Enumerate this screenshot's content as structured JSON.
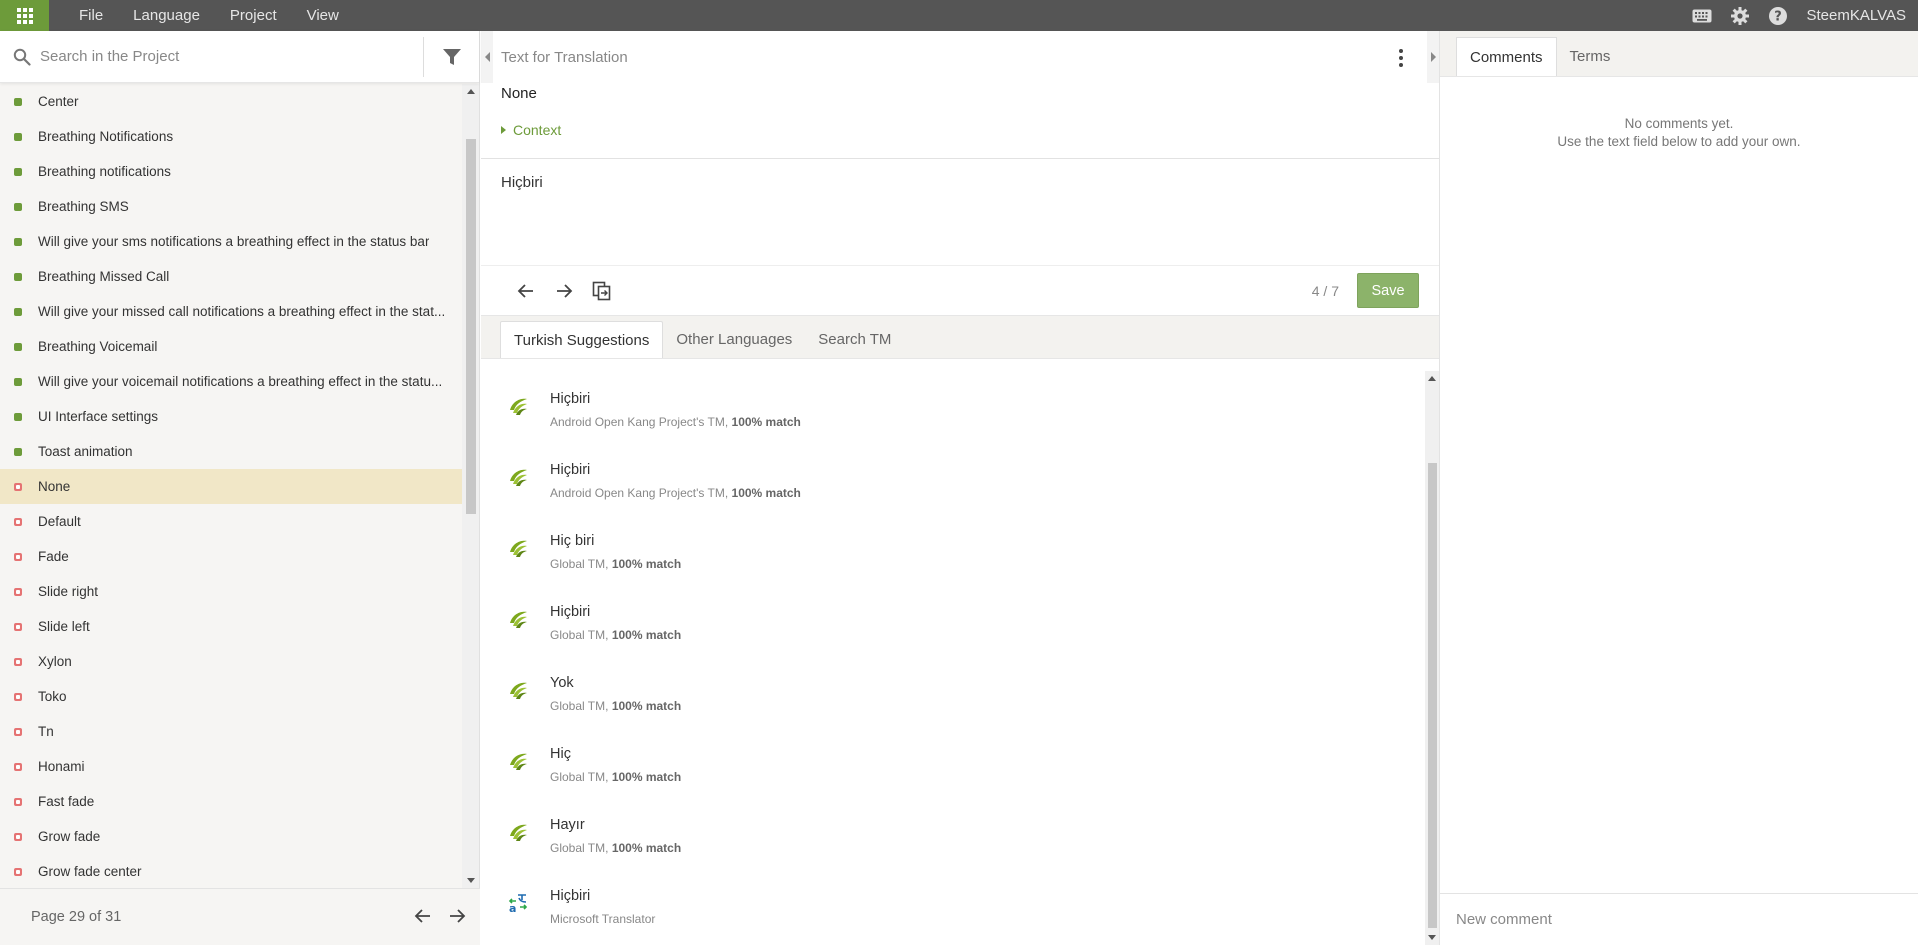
{
  "topbar": {
    "menu": [
      "File",
      "Language",
      "Project",
      "View"
    ],
    "user": "SteemKALVAS"
  },
  "left": {
    "search_placeholder": "Search in the Project",
    "strings": [
      {
        "text": "Center",
        "status": "translated"
      },
      {
        "text": "Breathing Notifications",
        "status": "translated"
      },
      {
        "text": "Breathing notifications",
        "status": "translated"
      },
      {
        "text": "Breathing SMS",
        "status": "translated"
      },
      {
        "text": "Will give your sms notifications a breathing effect in the status bar",
        "status": "translated"
      },
      {
        "text": "Breathing Missed Call",
        "status": "translated"
      },
      {
        "text": "Will give your missed call notifications a breathing effect in the stat...",
        "status": "translated"
      },
      {
        "text": "Breathing Voicemail",
        "status": "translated"
      },
      {
        "text": "Will give your voicemail notifications a breathing effect in the statu...",
        "status": "translated"
      },
      {
        "text": "UI Interface settings",
        "status": "translated"
      },
      {
        "text": "Toast animation",
        "status": "translated"
      },
      {
        "text": "None",
        "status": "untranslated",
        "selected": true
      },
      {
        "text": "Default",
        "status": "untranslated"
      },
      {
        "text": "Fade",
        "status": "untranslated"
      },
      {
        "text": "Slide right",
        "status": "untranslated"
      },
      {
        "text": "Slide left",
        "status": "untranslated"
      },
      {
        "text": "Xylon",
        "status": "untranslated"
      },
      {
        "text": "Toko",
        "status": "untranslated"
      },
      {
        "text": "Tn",
        "status": "untranslated"
      },
      {
        "text": "Honami",
        "status": "untranslated"
      },
      {
        "text": "Fast fade",
        "status": "untranslated"
      },
      {
        "text": "Grow fade",
        "status": "untranslated"
      },
      {
        "text": "Grow fade center",
        "status": "untranslated"
      }
    ],
    "page_label": "Page 29 of 31"
  },
  "editor": {
    "source_header": "Text for Translation",
    "source_text": "None",
    "context_label": "Context",
    "translation_text": "Hiçbiri",
    "counter": "4 / 7",
    "save_label": "Save",
    "tabs": [
      {
        "label": "Turkish Suggestions",
        "active": true
      },
      {
        "label": "Other Languages",
        "active": false
      },
      {
        "label": "Search TM",
        "active": false
      }
    ],
    "suggestions": [
      {
        "text": "Hiçbiri",
        "source": "Android Open Kang Project's TM,",
        "match": "100% match",
        "icon": "tm-icon"
      },
      {
        "text": "Hiçbiri",
        "source": "Android Open Kang Project's TM,",
        "match": "100% match",
        "icon": "tm-icon"
      },
      {
        "text": "Hiç biri",
        "source": "Global TM,",
        "match": "100% match",
        "icon": "tm-icon"
      },
      {
        "text": "Hiçbiri",
        "source": "Global TM,",
        "match": "100% match",
        "icon": "tm-icon"
      },
      {
        "text": "Yok",
        "source": "Global TM,",
        "match": "100% match",
        "icon": "tm-icon"
      },
      {
        "text": "Hiç",
        "source": "Global TM,",
        "match": "100% match",
        "icon": "tm-icon"
      },
      {
        "text": "Hayır",
        "source": "Global TM,",
        "match": "100% match",
        "icon": "tm-icon"
      },
      {
        "text": "Hiçbiri",
        "source": "Microsoft Translator",
        "match": "",
        "icon": "translator-icon"
      }
    ]
  },
  "right": {
    "tabs": [
      {
        "label": "Comments",
        "active": true
      },
      {
        "label": "Terms",
        "active": false
      }
    ],
    "no_comments_line1": "No comments yet.",
    "no_comments_line2": "Use the text field below to add your own.",
    "new_comment_placeholder": "New comment"
  },
  "colors": {
    "accent_green": "#6d9b3a",
    "untranslated_red": "#e57373",
    "selected_row": "#f1e7c7",
    "topbar": "#555555"
  }
}
